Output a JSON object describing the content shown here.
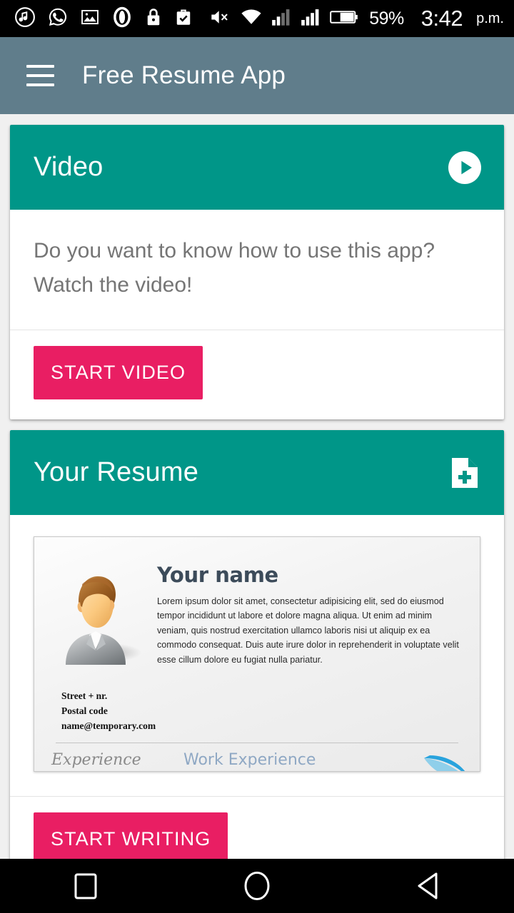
{
  "statusbar": {
    "left_icons": [
      "music-note-icon",
      "whatsapp-icon",
      "gallery-image-icon",
      "opera-icon",
      "lock-icon",
      "briefcase-check-icon"
    ],
    "right_icons": [
      "volume-mute-icon",
      "wifi-icon",
      "signal-bars-inactive-icon",
      "signal-bars-icon",
      "battery-icon"
    ],
    "battery_percent": "59%",
    "time": "3:42",
    "ampm": "p.m."
  },
  "appbar": {
    "menu_icon": "hamburger-menu-icon",
    "title": "Free Resume App",
    "background": "#607d8b"
  },
  "theme": {
    "accent_teal": "#009688",
    "accent_pink": "#e91e63",
    "page_background": "#f0f0f0"
  },
  "video_card": {
    "title": "Video",
    "action_icon": "play-circle-icon",
    "body_text": "Do you want to know how to use this app? Watch the video!",
    "button_label": "START VIDEO"
  },
  "resume_card": {
    "title": "Your Resume",
    "action_icon": "document-add-icon",
    "button_label": "START WRITING",
    "preview": {
      "name": "Your name",
      "summary": "Lorem ipsum dolor sit amet, consectetur adipisicing elit, sed do eiusmod tempor incididunt ut labore et dolore magna aliqua. Ut enim ad minim veniam, quis nostrud exercitation ullamco laboris nisi ut aliquip ex ea commodo consequat. Duis aute irure dolor in reprehenderit in voluptate velit esse cillum dolore eu fugiat nulla pariatur.",
      "contact_line1": "Street + nr.",
      "contact_line2": "Postal code",
      "contact_line3": "name@temporary.com",
      "section_left": "Experience",
      "section_right": "Work Experience",
      "avatar_icon": "person-avatar-illustration"
    }
  },
  "navbar": {
    "recents_label": "recents-square-icon",
    "home_label": "home-circle-icon",
    "back_label": "back-triangle-icon"
  }
}
